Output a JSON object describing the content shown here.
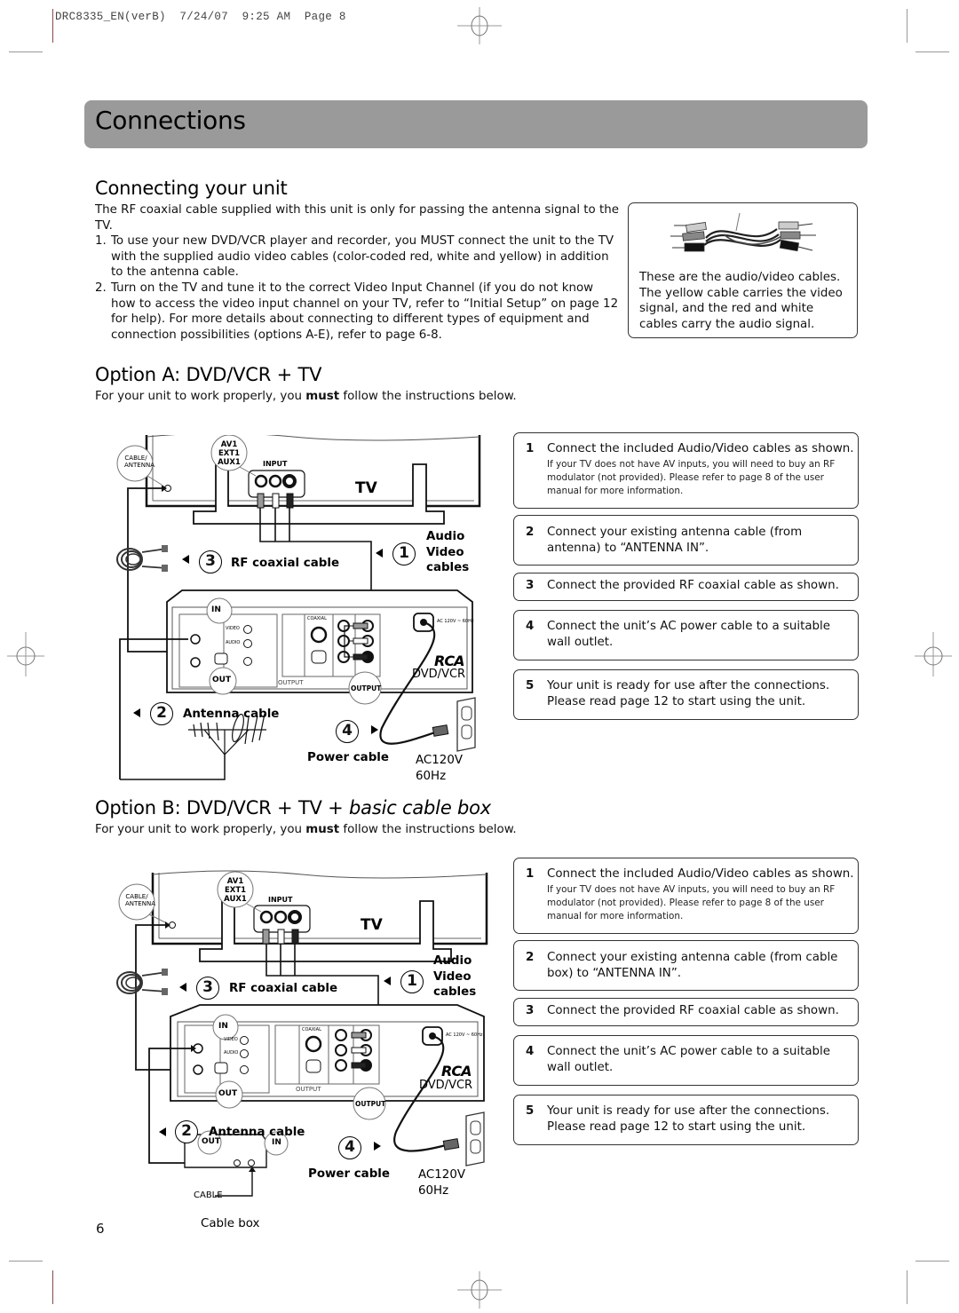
{
  "print_slug": "DRC8335_EN(verB)  7/24/07  9:25 AM  Page 8",
  "banner": {
    "title": "Connections",
    "color": "#9a9a9a"
  },
  "intro": {
    "heading": "Connecting your unit",
    "paragraph": "The RF coaxial cable supplied with this unit is only for passing the antenna signal to the TV.",
    "items": [
      {
        "num": "1.",
        "text": "To use your new DVD/VCR player and recorder, you MUST connect the unit to the TV with the supplied audio video cables (color-coded red, white and yellow) in addition to the antenna cable."
      },
      {
        "num": "2.",
        "text": "Turn on the TV and tune it to the correct Video Input Channel (if you do not know how to access the video input channel on your TV, refer to “Initial Setup” on page 12 for help). For more details about connecting to different types of equipment and connection possibilities (options A-E), refer to page 6-8."
      }
    ],
    "cable_caption": "These are the audio/video cables. The yellow cable carries the video signal, and the red and white cables carry the audio signal."
  },
  "option_a": {
    "heading": "Option A: DVD/VCR + TV",
    "sub_before": "For your unit to work properly, you ",
    "sub_bold": "must",
    "sub_after": " follow the instructions below.",
    "diagram": {
      "tv_label": "TV",
      "tv_input_label": "INPUT",
      "tv_input_callout": [
        "AV1",
        "EXT1",
        "AUX1"
      ],
      "tv_antenna_callout": [
        "CABLE/",
        "ANTENNA"
      ],
      "step1_num": "1",
      "step1_label": [
        "Audio",
        "Video",
        "cables"
      ],
      "step3_num": "3",
      "step3_label": "RF coaxial cable",
      "step2_num": "2",
      "step2_label": "Antenna cable",
      "step4_num": "4",
      "step4_label": "Power cable",
      "power_spec": [
        "AC120V",
        "60Hz"
      ],
      "unit_brand": "RCA",
      "unit_label": "DVD/VCR",
      "callout_in": "IN",
      "callout_out": "OUT",
      "callout_output": "OUTPUT",
      "panel_output": "OUTPUT",
      "panel_coaxial": "COAXIAL",
      "panel_video": "VIDEO",
      "panel_audio": "AUDIO",
      "panel_ac": "AC 120V ~ 60Hz"
    },
    "steps": [
      {
        "num": "1",
        "text": "Connect the included Audio/Video cables as shown.",
        "note": "If your TV does not have AV inputs, you will need to buy an RF modulator (not provided). Please refer to page 8 of the user manual for more information."
      },
      {
        "num": "2",
        "text": "Connect your existing antenna cable (from antenna) to “ANTENNA IN”."
      },
      {
        "num": "3",
        "text": "Connect the provided RF coaxial cable as shown."
      },
      {
        "num": "4",
        "text": "Connect the unit’s AC power cable to a suitable wall outlet."
      },
      {
        "num": "5",
        "text": "Your unit is ready for use after the connections. Please read page 12 to start using the unit."
      }
    ]
  },
  "option_b": {
    "heading_plain": "Option B: DVD/VCR + TV + ",
    "heading_italic": "basic cable box",
    "sub_before": "For your unit to work properly, you ",
    "sub_bold": "must",
    "sub_after": " follow the instructions below.",
    "diagram": {
      "tv_label": "TV",
      "tv_input_label": "INPUT",
      "tv_input_callout": [
        "AV1",
        "EXT1",
        "AUX1"
      ],
      "tv_antenna_callout": [
        "CABLE/",
        "ANTENNA"
      ],
      "step1_num": "1",
      "step1_label": [
        "Audio",
        "Video",
        "cables"
      ],
      "step3_num": "3",
      "step3_label": "RF coaxial cable",
      "step2_num": "2",
      "step2_label": "Antenna cable",
      "step4_num": "4",
      "step4_label": "Power cable",
      "power_spec": [
        "AC120V",
        "60Hz"
      ],
      "unit_brand": "RCA",
      "unit_label": "DVD/VCR",
      "callout_in": "IN",
      "callout_out": "OUT",
      "callout_output": "OUTPUT",
      "panel_output": "OUTPUT",
      "panel_coaxial": "COAXIAL",
      "panel_video": "VIDEO",
      "panel_audio": "AUDIO",
      "panel_ac": "AC 120V ~ 60Hz",
      "cablebox_out": "OUT",
      "cablebox_in": "IN",
      "cablebox_cable": "CABLE",
      "cablebox_label": "Cable box"
    },
    "steps": [
      {
        "num": "1",
        "text": "Connect the included Audio/Video cables as shown.",
        "note": "If your TV does not have AV inputs, you will need to buy an RF modulator (not provided). Please refer to page 8 of the user manual for more information."
      },
      {
        "num": "2",
        "text": "Connect your existing antenna cable (from cable box) to “ANTENNA IN”."
      },
      {
        "num": "3",
        "text": "Connect the provided RF coaxial cable as shown."
      },
      {
        "num": "4",
        "text": "Connect the unit’s AC power cable to a suitable wall outlet."
      },
      {
        "num": "5",
        "text": "Your unit is ready for use after the connections. Please read page 12 to start using the unit."
      }
    ]
  },
  "page_number": "6"
}
